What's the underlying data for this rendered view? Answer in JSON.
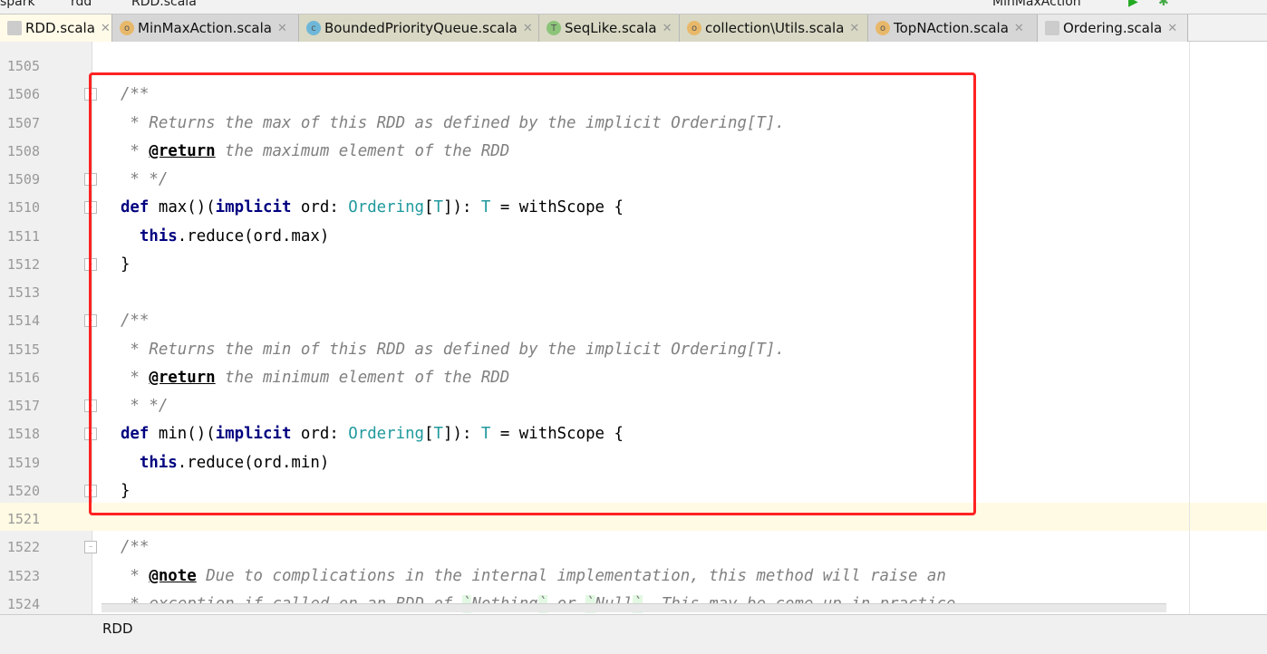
{
  "breadcrumb": [
    "spark",
    "rdd",
    "RDD.scala"
  ],
  "run_config": "MinMaxAction",
  "tabs": [
    {
      "label": "RDD.scala",
      "icon": "scala-file-icon",
      "active": true,
      "bg": "#fffbe8"
    },
    {
      "label": "MinMaxAction.scala",
      "icon": "object-icon",
      "bg": "#d6d6d6"
    },
    {
      "label": "BoundedPriorityQueue.scala",
      "icon": "class-icon",
      "bg": "#d8d8c4"
    },
    {
      "label": "SeqLike.scala",
      "icon": "trait-icon",
      "bg": "#d8d8c4"
    },
    {
      "label": "collection\\Utils.scala",
      "icon": "object-icon",
      "bg": "#d8d8c4"
    },
    {
      "label": "TopNAction.scala",
      "icon": "object-icon",
      "bg": "#d6d6d6"
    },
    {
      "label": "Ordering.scala",
      "icon": "scala-file-icon",
      "bg": "#e8e8e8"
    }
  ],
  "lines": [
    {
      "n": "1505",
      "t": []
    },
    {
      "n": "1506",
      "t": [
        [
          "cm",
          "  /**"
        ]
      ]
    },
    {
      "n": "1507",
      "t": [
        [
          "cm",
          "   * Returns the max of this RDD as defined by the implicit Ordering[T]."
        ]
      ]
    },
    {
      "n": "1508",
      "t": [
        [
          "cm",
          "   * "
        ],
        [
          "tag",
          "@return"
        ],
        [
          "cm",
          " the maximum element of the RDD"
        ]
      ]
    },
    {
      "n": "1509",
      "t": [
        [
          "cm",
          "   * */"
        ]
      ]
    },
    {
      "n": "1510",
      "t": [
        [
          "",
          "  "
        ],
        [
          "kw",
          "def"
        ],
        [
          "",
          " max()("
        ],
        [
          "kw",
          "implicit"
        ],
        [
          "",
          " ord: "
        ],
        [
          "ty",
          "Ordering"
        ],
        [
          "",
          "["
        ],
        [
          "ty",
          "T"
        ],
        [
          "",
          "]): "
        ],
        [
          "ty",
          "T"
        ],
        [
          "",
          " = withScope {"
        ]
      ]
    },
    {
      "n": "1511",
      "t": [
        [
          "",
          "    "
        ],
        [
          "kw",
          "this"
        ],
        [
          "",
          ".reduce(ord.max)"
        ]
      ]
    },
    {
      "n": "1512",
      "t": [
        [
          "",
          "  }"
        ]
      ]
    },
    {
      "n": "1513",
      "t": []
    },
    {
      "n": "1514",
      "t": [
        [
          "cm",
          "  /**"
        ]
      ]
    },
    {
      "n": "1515",
      "t": [
        [
          "cm",
          "   * Returns the min of this RDD as defined by the implicit Ordering[T]."
        ]
      ]
    },
    {
      "n": "1516",
      "t": [
        [
          "cm",
          "   * "
        ],
        [
          "tag",
          "@return"
        ],
        [
          "cm",
          " the minimum element of the RDD"
        ]
      ]
    },
    {
      "n": "1517",
      "t": [
        [
          "cm",
          "   * */"
        ]
      ]
    },
    {
      "n": "1518",
      "t": [
        [
          "",
          "  "
        ],
        [
          "kw",
          "def"
        ],
        [
          "",
          " min()("
        ],
        [
          "kw",
          "implicit"
        ],
        [
          "",
          " ord: "
        ],
        [
          "ty",
          "Ordering"
        ],
        [
          "",
          "["
        ],
        [
          "ty",
          "T"
        ],
        [
          "",
          "]): "
        ],
        [
          "ty",
          "T"
        ],
        [
          "",
          " = withScope {"
        ]
      ]
    },
    {
      "n": "1519",
      "t": [
        [
          "",
          "    "
        ],
        [
          "kw",
          "this"
        ],
        [
          "",
          ".reduce(ord.min)"
        ]
      ]
    },
    {
      "n": "1520",
      "t": [
        [
          "",
          "  }"
        ]
      ]
    },
    {
      "n": "1521",
      "t": []
    },
    {
      "n": "1522",
      "t": [
        [
          "cm",
          "  /**"
        ]
      ]
    },
    {
      "n": "1523",
      "t": [
        [
          "cm",
          "   * "
        ],
        [
          "tag",
          "@note"
        ],
        [
          "cm",
          " Due to complications in the internal implementation, this method will raise an"
        ]
      ]
    },
    {
      "n": "1524",
      "t": [
        [
          "cm",
          "   * exception if called on an RDD of "
        ],
        [
          "cm bt",
          "`"
        ],
        [
          "cm",
          "Nothing"
        ],
        [
          "cm bt",
          "`"
        ],
        [
          "cm",
          " or "
        ],
        [
          "cm bt",
          "`"
        ],
        [
          "cm",
          "Null"
        ],
        [
          "cm bt",
          "`"
        ],
        [
          "cm",
          ". This may be come up in practice"
        ]
      ]
    }
  ],
  "status": {
    "context": "RDD"
  },
  "colors": {
    "highlight_box": "#ff2222",
    "keyword": "#000080",
    "type": "#20999d",
    "comment": "#808080",
    "current_line": "#fffae3"
  }
}
